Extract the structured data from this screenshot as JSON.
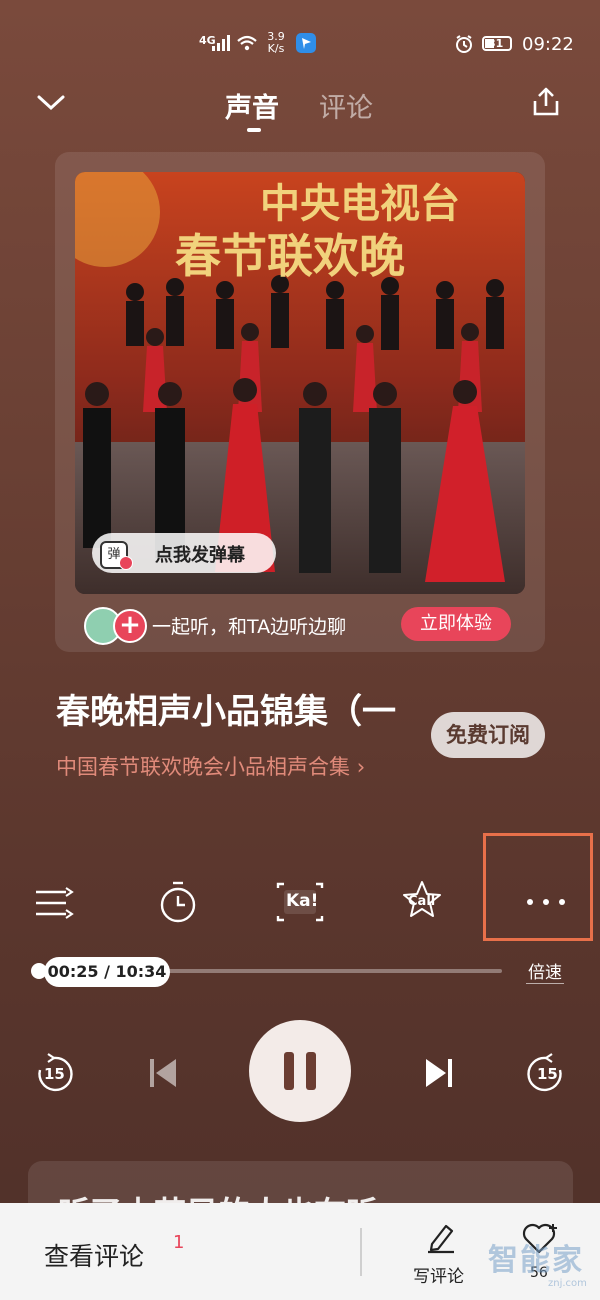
{
  "status_bar": {
    "network": "4G",
    "speed_value": "3.9",
    "speed_unit": "K/s",
    "battery": "31",
    "time": "09:22"
  },
  "header": {
    "tabs": [
      {
        "label": "声音",
        "active": true
      },
      {
        "label": "评论",
        "active": false
      }
    ]
  },
  "cover": {
    "danmu_icon": "弹",
    "danmu_label": "点我发弹幕",
    "cover_text_line1": "中央电视台",
    "cover_text_line2": "春节联欢晚"
  },
  "listen_together": {
    "text": "一起听，和TA边听边聊",
    "button": "立即体验"
  },
  "track": {
    "title": "春晚相声小品锦集（一",
    "album": "中国春节联欢晚会小品相声合集",
    "subscribe": "免费订阅"
  },
  "controls": {
    "icons": [
      "playlist-icon",
      "timer-icon",
      "karaoke-icon",
      "call-icon",
      "more-icon"
    ],
    "karaoke_label": "Ka!",
    "call_label": "Call"
  },
  "progress": {
    "current": "00:25",
    "total": "10:34",
    "time_label": "00:25 / 10:34",
    "fraction": 0.04,
    "speed_label": "倍速"
  },
  "playback": {
    "rewind_seconds": "15",
    "forward_seconds": "15"
  },
  "lower_card": {
    "text": "听了本节目的人也在听"
  },
  "bottom_bar": {
    "view_comments": "查看评论",
    "comment_count": "1",
    "write_comment": "写评论",
    "like_count": "56"
  },
  "watermark": {
    "main": "智能家",
    "sub": "znj.com"
  },
  "colors": {
    "accent": "#e8455a",
    "highlight_box": "#e8704a",
    "album_link": "#e08a7a"
  }
}
